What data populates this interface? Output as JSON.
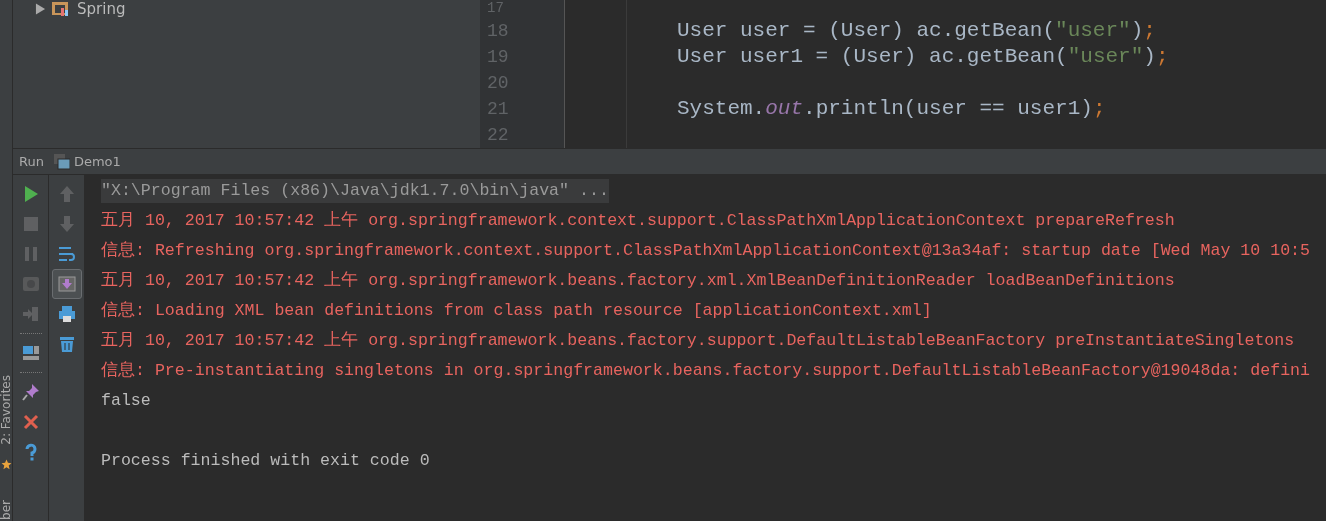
{
  "project_tree": {
    "items": [
      {
        "label": "Spring",
        "expanded": false
      }
    ]
  },
  "editor": {
    "lines": [
      {
        "number": "17"
      },
      {
        "number": "18",
        "tokens": [
          {
            "kind": "plain",
            "text": "User user = (User) ac.getBean("
          },
          {
            "kind": "string",
            "text": "\"user\""
          },
          {
            "kind": "plain",
            "text": ")"
          },
          {
            "kind": "punct",
            "text": ";"
          }
        ]
      },
      {
        "number": "19",
        "tokens": [
          {
            "kind": "plain",
            "text": "User user1 = (User) ac.getBean("
          },
          {
            "kind": "string",
            "text": "\"user\""
          },
          {
            "kind": "plain",
            "text": ")"
          },
          {
            "kind": "punct",
            "text": ";"
          }
        ]
      },
      {
        "number": "20"
      },
      {
        "number": "21",
        "tokens": [
          {
            "kind": "plain",
            "text": "System."
          },
          {
            "kind": "field",
            "text": "out"
          },
          {
            "kind": "plain",
            "text": ".println(user == user1)"
          },
          {
            "kind": "punct",
            "text": ";"
          }
        ]
      },
      {
        "number": "22"
      }
    ]
  },
  "run_panel": {
    "title": "Run",
    "config": "Demo1",
    "left_tools": [
      {
        "kind": "run",
        "disabled": false
      },
      {
        "kind": "stop",
        "disabled": true
      },
      {
        "kind": "pause",
        "disabled": true
      },
      {
        "kind": "camera",
        "disabled": true
      },
      {
        "kind": "exit",
        "disabled": true
      },
      {
        "kind": "separator"
      },
      {
        "kind": "layout",
        "disabled": false
      },
      {
        "kind": "separator"
      },
      {
        "kind": "pin",
        "disabled": false
      },
      {
        "kind": "close",
        "disabled": false
      },
      {
        "kind": "help",
        "disabled": false
      }
    ],
    "right_tools": [
      {
        "kind": "up",
        "disabled": true,
        "on": false
      },
      {
        "kind": "down",
        "disabled": true,
        "on": false
      },
      {
        "kind": "wrap",
        "disabled": false,
        "on": false
      },
      {
        "kind": "scroll",
        "disabled": false,
        "on": true
      },
      {
        "kind": "print",
        "disabled": false,
        "on": false
      },
      {
        "kind": "trash",
        "disabled": false,
        "on": false
      }
    ],
    "console": [
      {
        "kind": "command",
        "text": "\"X:\\Program Files (x86)\\Java\\jdk1.7.0\\bin\\java\" ..."
      },
      {
        "kind": "error",
        "text": "五月 10, 2017 10:57:42 上午 org.springframework.context.support.ClassPathXmlApplicationContext prepareRefresh"
      },
      {
        "kind": "error",
        "text": "信息: Refreshing org.springframework.context.support.ClassPathXmlApplicationContext@13a34af: startup date [Wed May 10 10:5"
      },
      {
        "kind": "error",
        "text": "五月 10, 2017 10:57:42 上午 org.springframework.beans.factory.xml.XmlBeanDefinitionReader loadBeanDefinitions"
      },
      {
        "kind": "error",
        "text": "信息: Loading XML bean definitions from class path resource [applicationContext.xml]"
      },
      {
        "kind": "error",
        "text": "五月 10, 2017 10:57:42 上午 org.springframework.beans.factory.support.DefaultListableBeanFactory preInstantiateSingletons"
      },
      {
        "kind": "error",
        "text": "信息: Pre-instantiating singletons in org.springframework.beans.factory.support.DefaultListableBeanFactory@19048da: defini"
      },
      {
        "kind": "output",
        "text": "false"
      },
      {
        "kind": "blank"
      },
      {
        "kind": "output",
        "text": "Process finished with exit code 0"
      }
    ]
  },
  "side_strip": {
    "tool_windows": [
      {
        "label": "2: Favorites"
      },
      {
        "label": "ber"
      }
    ]
  }
}
